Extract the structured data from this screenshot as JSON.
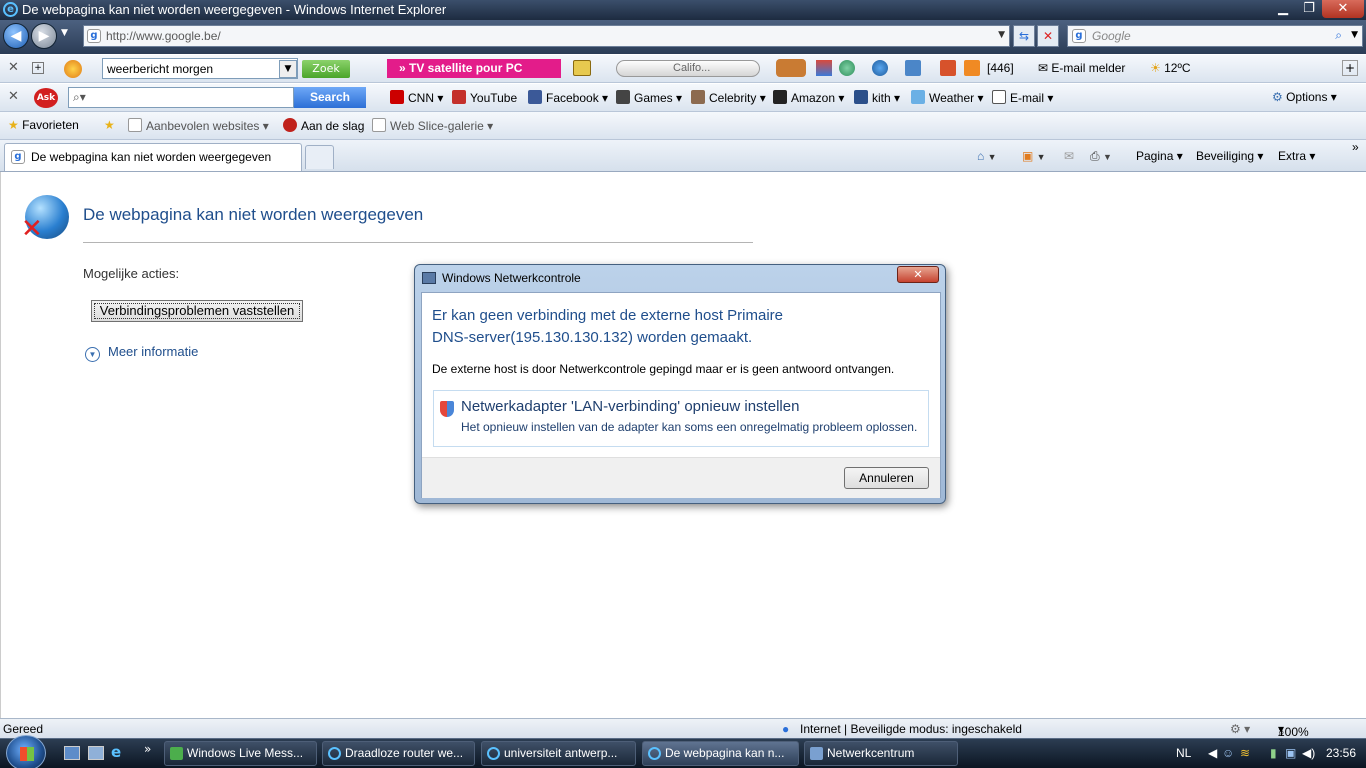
{
  "window": {
    "title": "De webpagina kan niet worden weergegeven - Windows Internet Explorer"
  },
  "address": {
    "url": "http://www.google.be/",
    "search_placeholder": "Google"
  },
  "toolbar1": {
    "search_value": "weerbericht morgen",
    "zoek": "Zoek",
    "tv": "» TV satellite pour PC",
    "media": "Califo...",
    "count": "[446]",
    "email": "E-mail melder",
    "temp": "12ºC"
  },
  "toolbar2": {
    "ask": "Ask",
    "search_btn": "Search",
    "links": [
      "CNN",
      "YouTube",
      "Facebook",
      "Games",
      "Celebrity",
      "Amazon",
      "kith",
      "Weather",
      "E-mail"
    ],
    "options": "Options"
  },
  "favbar": {
    "favorites": "Favorieten",
    "items": [
      "Aanbevolen websites",
      "Aan de slag",
      "Web Slice-galerie"
    ]
  },
  "tab": {
    "title": "De webpagina kan niet worden weergegeven"
  },
  "commandbar": {
    "pagina": "Pagina",
    "beveiliging": "Beveiliging",
    "extra": "Extra"
  },
  "error_page": {
    "title": "De webpagina kan niet worden weergegeven",
    "actions_label": "Mogelijke acties:",
    "diagnose_button": "Verbindingsproblemen vaststellen",
    "more_info": "Meer informatie"
  },
  "dialog": {
    "title": "Windows Netwerkcontrole",
    "main_line1": "Er kan geen verbinding met de externe host Primaire",
    "main_line2": "DNS-server(195.130.130.132) worden gemaakt.",
    "sub": "De externe host is door Netwerkcontrole gepingd maar er is geen antwoord ontvangen.",
    "option_title": "Netwerkadapter 'LAN-verbinding' opnieuw instellen",
    "option_sub": "Het opnieuw instellen van de adapter kan soms een onregelmatig probleem oplossen.",
    "cancel": "Annuleren"
  },
  "status": {
    "left": "Gereed",
    "zone": "Internet | Beveiligde modus: ingeschakeld",
    "zoom": "100%"
  },
  "taskbar": {
    "buttons": [
      "Windows Live Mess...",
      "Draadloze router we...",
      "universiteit antwerp...",
      "De webpagina kan n...",
      "Netwerkcentrum"
    ],
    "lang": "NL",
    "time": "23:56"
  }
}
